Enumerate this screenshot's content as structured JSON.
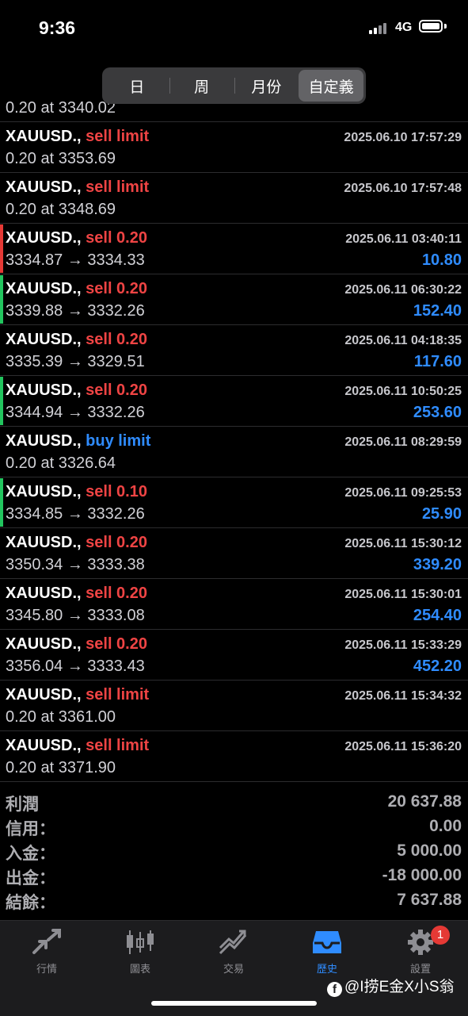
{
  "status": {
    "time": "9:36",
    "network": "4G"
  },
  "segments": [
    {
      "label": "日",
      "active": false
    },
    {
      "label": "周",
      "active": false
    },
    {
      "label": "月份",
      "active": false
    },
    {
      "label": "自定義",
      "active": true
    }
  ],
  "partial_row": {
    "detail": "0.20 at 3340.02"
  },
  "orders": [
    {
      "symbol": "XAUUSD.,",
      "type": " sell limit",
      "side": "sell",
      "date": "2025.06.10 17:57:29",
      "detail": "0.20 at 3353.69",
      "profit": "",
      "bar": ""
    },
    {
      "symbol": "XAUUSD.,",
      "type": " sell limit",
      "side": "sell",
      "date": "2025.06.10 17:57:48",
      "detail": "0.20 at 3348.69",
      "profit": "",
      "bar": ""
    },
    {
      "symbol": "XAUUSD.,",
      "type": " sell 0.20",
      "side": "sell",
      "date": "2025.06.11 03:40:11",
      "detail": "3334.87 → 3334.33",
      "profit": "10.80",
      "bar": "red"
    },
    {
      "symbol": "XAUUSD.,",
      "type": " sell 0.20",
      "side": "sell",
      "date": "2025.06.11 06:30:22",
      "detail": "3339.88 → 3332.26",
      "profit": "152.40",
      "bar": "green"
    },
    {
      "symbol": "XAUUSD.,",
      "type": " sell 0.20",
      "side": "sell",
      "date": "2025.06.11 04:18:35",
      "detail": "3335.39 → 3329.51",
      "profit": "117.60",
      "bar": ""
    },
    {
      "symbol": "XAUUSD.,",
      "type": " sell 0.20",
      "side": "sell",
      "date": "2025.06.11 10:50:25",
      "detail": "3344.94 → 3332.26",
      "profit": "253.60",
      "bar": "green"
    },
    {
      "symbol": "XAUUSD.,",
      "type": " buy limit",
      "side": "buy",
      "date": "2025.06.11 08:29:59",
      "detail": "0.20 at 3326.64",
      "profit": "",
      "bar": ""
    },
    {
      "symbol": "XAUUSD.,",
      "type": " sell 0.10",
      "side": "sell",
      "date": "2025.06.11 09:25:53",
      "detail": "3334.85 → 3332.26",
      "profit": "25.90",
      "bar": "green"
    },
    {
      "symbol": "XAUUSD.,",
      "type": " sell 0.20",
      "side": "sell",
      "date": "2025.06.11 15:30:12",
      "detail": "3350.34 → 3333.38",
      "profit": "339.20",
      "bar": ""
    },
    {
      "symbol": "XAUUSD.,",
      "type": " sell 0.20",
      "side": "sell",
      "date": "2025.06.11 15:30:01",
      "detail": "3345.80 → 3333.08",
      "profit": "254.40",
      "bar": ""
    },
    {
      "symbol": "XAUUSD.,",
      "type": " sell 0.20",
      "side": "sell",
      "date": "2025.06.11 15:33:29",
      "detail": "3356.04 → 3333.43",
      "profit": "452.20",
      "bar": ""
    },
    {
      "symbol": "XAUUSD.,",
      "type": " sell limit",
      "side": "sell",
      "date": "2025.06.11 15:34:32",
      "detail": "0.20 at 3361.00",
      "profit": "",
      "bar": ""
    },
    {
      "symbol": "XAUUSD.,",
      "type": " sell limit",
      "side": "sell",
      "date": "2025.06.11 15:36:20",
      "detail": "0.20 at 3371.90",
      "profit": "",
      "bar": ""
    }
  ],
  "summary": [
    {
      "label": "利潤",
      "value": "20 637.88"
    },
    {
      "label": "信用：",
      "value": "0.00"
    },
    {
      "label": "入金：",
      "value": "5 000.00"
    },
    {
      "label": "出金：",
      "value": "-18 000.00"
    },
    {
      "label": "結餘：",
      "value": "7 637.88"
    }
  ],
  "tabs": [
    {
      "label": "行情",
      "icon": "quotes-arrows-icon",
      "active": false
    },
    {
      "label": "圖表",
      "icon": "candlestick-chart-icon",
      "active": false
    },
    {
      "label": "交易",
      "icon": "trade-trend-icon",
      "active": false
    },
    {
      "label": "歷史",
      "icon": "history-tray-icon",
      "active": true
    },
    {
      "label": "設置",
      "icon": "gear-icon",
      "active": false,
      "badge": "1"
    }
  ],
  "watermark": "@I捞E金X小S翁",
  "colors": {
    "sell": "#ef4444",
    "buy": "#2f8cff",
    "profit": "#2f8cff",
    "bar_red": "#e53935",
    "bar_green": "#22c55e",
    "active_tab": "#2f8cff"
  }
}
